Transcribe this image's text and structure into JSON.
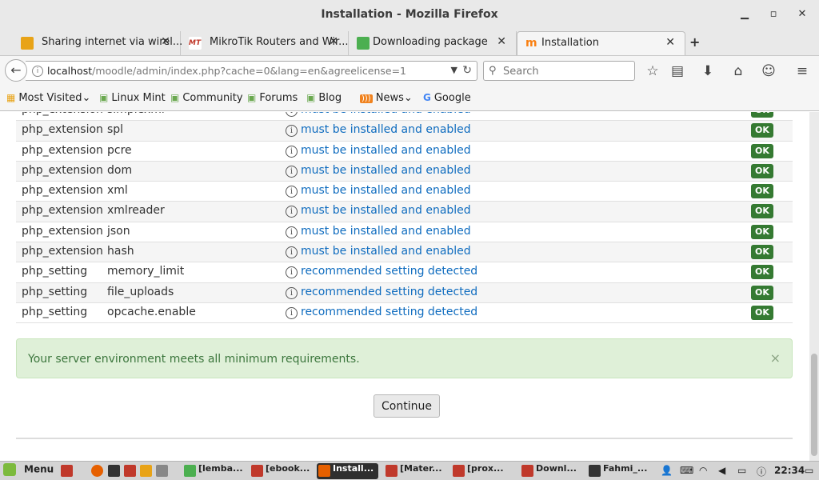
{
  "window": {
    "title": "Installation - Mozilla Firefox",
    "minimize": "▁",
    "maximize": "▫",
    "close": "✕"
  },
  "tabs": [
    {
      "label": "Sharing internet via wirel...",
      "close": "✕",
      "icon": "shared-icon",
      "color": "#e8a317"
    },
    {
      "label": "MikroTik Routers and Wir...",
      "close": "✕",
      "icon": "mikrotik-icon",
      "color": "#c0392b"
    },
    {
      "label": "Downloading package",
      "close": "✕",
      "icon": "download-page-icon",
      "color": "#4caf50"
    },
    {
      "label": "Installation",
      "close": "✕",
      "icon": "moodle-icon",
      "color": "#f98012"
    }
  ],
  "newtab": "+",
  "nav": {
    "url_host": "localhost",
    "url_path": "/moodle/admin/index.php?cache=0&lang=en&agreelicense=1",
    "search_placeholder": "Search"
  },
  "bookmarks": [
    {
      "label": "Most Visited",
      "icon": "most-visited-icon",
      "suffix": "⌄"
    },
    {
      "label": "Linux Mint",
      "icon": "mint-icon"
    },
    {
      "label": "Community",
      "icon": "mint-icon"
    },
    {
      "label": "Forums",
      "icon": "mint-icon"
    },
    {
      "label": "Blog",
      "icon": "mint-icon"
    },
    {
      "label": "News",
      "icon": "rss-icon",
      "suffix": "⌄"
    },
    {
      "label": "Google",
      "icon": "google-icon"
    }
  ],
  "requirements": [
    {
      "type": "php_extension",
      "name": "simplexml",
      "status": "must be installed and enabled",
      "result": "OK"
    },
    {
      "type": "php_extension",
      "name": "spl",
      "status": "must be installed and enabled",
      "result": "OK"
    },
    {
      "type": "php_extension",
      "name": "pcre",
      "status": "must be installed and enabled",
      "result": "OK"
    },
    {
      "type": "php_extension",
      "name": "dom",
      "status": "must be installed and enabled",
      "result": "OK"
    },
    {
      "type": "php_extension",
      "name": "xml",
      "status": "must be installed and enabled",
      "result": "OK"
    },
    {
      "type": "php_extension",
      "name": "xmlreader",
      "status": "must be installed and enabled",
      "result": "OK"
    },
    {
      "type": "php_extension",
      "name": "json",
      "status": "must be installed and enabled",
      "result": "OK"
    },
    {
      "type": "php_extension",
      "name": "hash",
      "status": "must be installed and enabled",
      "result": "OK"
    },
    {
      "type": "php_setting",
      "name": "memory_limit",
      "status": "recommended setting detected",
      "result": "OK"
    },
    {
      "type": "php_setting",
      "name": "file_uploads",
      "status": "recommended setting detected",
      "result": "OK"
    },
    {
      "type": "php_setting",
      "name": "opcache.enable",
      "status": "recommended setting detected",
      "result": "OK"
    }
  ],
  "alert": {
    "message": "Your server environment meets all minimum requirements.",
    "close": "×"
  },
  "continue_label": "Continue",
  "taskbar": {
    "menu_label": "Menu",
    "tasks": [
      {
        "label": "[lemba...",
        "color": "#4caf50"
      },
      {
        "label": "[ebook...",
        "color": "#c0392b"
      },
      {
        "label": "Install...",
        "color": "#e66000",
        "active": true
      },
      {
        "label": "[Mater...",
        "color": "#c0392b"
      },
      {
        "label": "[prox...",
        "color": "#c0392b"
      },
      {
        "label": "Downl...",
        "color": "#c0392b"
      },
      {
        "label": "Fahmi_...",
        "color": "#333333"
      }
    ],
    "clock": "22:34"
  }
}
